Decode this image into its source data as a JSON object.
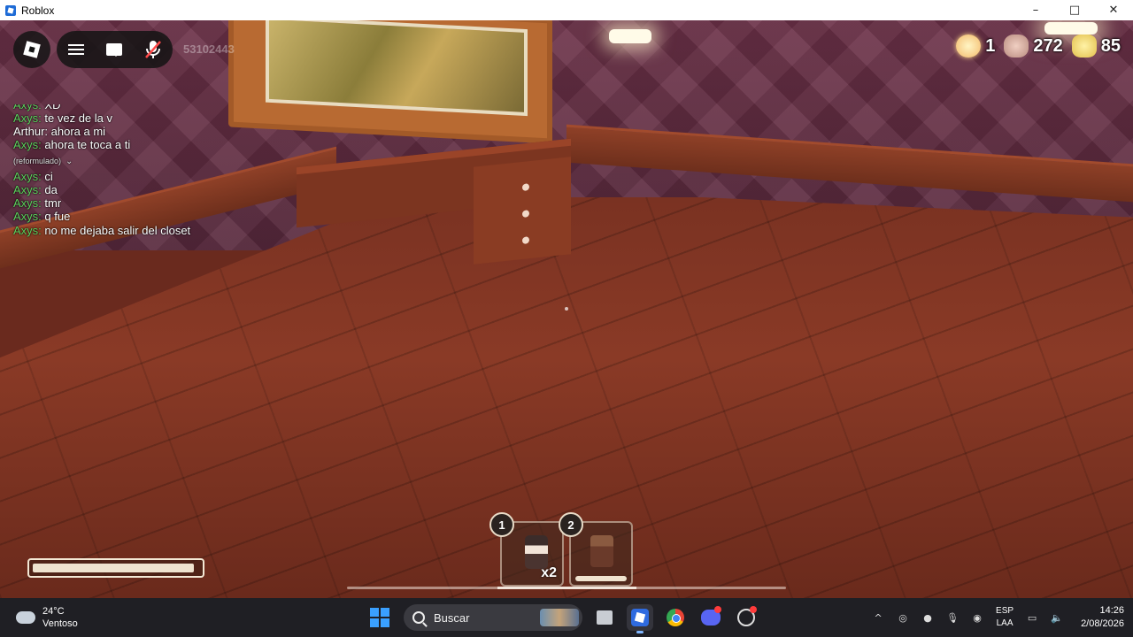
{
  "window": {
    "title": "Roblox",
    "controls": {
      "minimize": "–",
      "maximize": "□",
      "close": "✕"
    }
  },
  "game": {
    "player_id": "53102443",
    "topbar_icons": [
      "roblox-logo-icon",
      "menu-icon",
      "chat-icon",
      "mic-muted-icon"
    ],
    "chat": {
      "clipped_line": {
        "name": "Axys:",
        "text": "XD"
      },
      "before_meta": [
        {
          "name": "Axys:",
          "text": "te vez de la v",
          "color": "#5fd35f"
        },
        {
          "name": "Arthur:",
          "text": "ahora a mi",
          "color": "#ffffff"
        },
        {
          "name": "Axys:",
          "text": "ahora te toca a ti",
          "color": "#5fd35f"
        }
      ],
      "meta_label": "(reformulado)",
      "after_meta": [
        {
          "name": "Axys:",
          "text": "ci",
          "color": "#5fd35f"
        },
        {
          "name": "Axys:",
          "text": "da",
          "color": "#5fd35f"
        },
        {
          "name": "Axys:",
          "text": "tmr",
          "color": "#5fd35f"
        },
        {
          "name": "Axys:",
          "text": "q fue",
          "color": "#5fd35f"
        },
        {
          "name": "Axys:",
          "text": "no me dejaba salir del closet",
          "color": "#5fd35f"
        }
      ]
    },
    "currency": [
      {
        "icon": "sun-currency-icon",
        "value": "1"
      },
      {
        "icon": "stone-currency-icon",
        "value": "272"
      },
      {
        "icon": "gold-currency-icon",
        "value": "85"
      }
    ],
    "health": {
      "fraction": 0.97
    },
    "hotbar": {
      "slots": [
        {
          "number": "1",
          "icon": "jar-item-icon",
          "count": "x2"
        },
        {
          "number": "2",
          "icon": "lighter-item-icon",
          "count": "",
          "durability": 1.0
        }
      ]
    }
  },
  "taskbar": {
    "weather": {
      "temp": "24°C",
      "desc": "Ventoso"
    },
    "search_label": "Buscar",
    "apps": [
      "files-icon",
      "roblox-icon",
      "chrome-icon",
      "discord-icon",
      "obs-icon"
    ],
    "tray": {
      "lang_top": "ESP",
      "lang_bottom": "LAA",
      "time": "14:26",
      "date": "2/08/2026"
    },
    "colors": {
      "background": "#1f1f24",
      "accent": "#3aa0ff"
    }
  }
}
